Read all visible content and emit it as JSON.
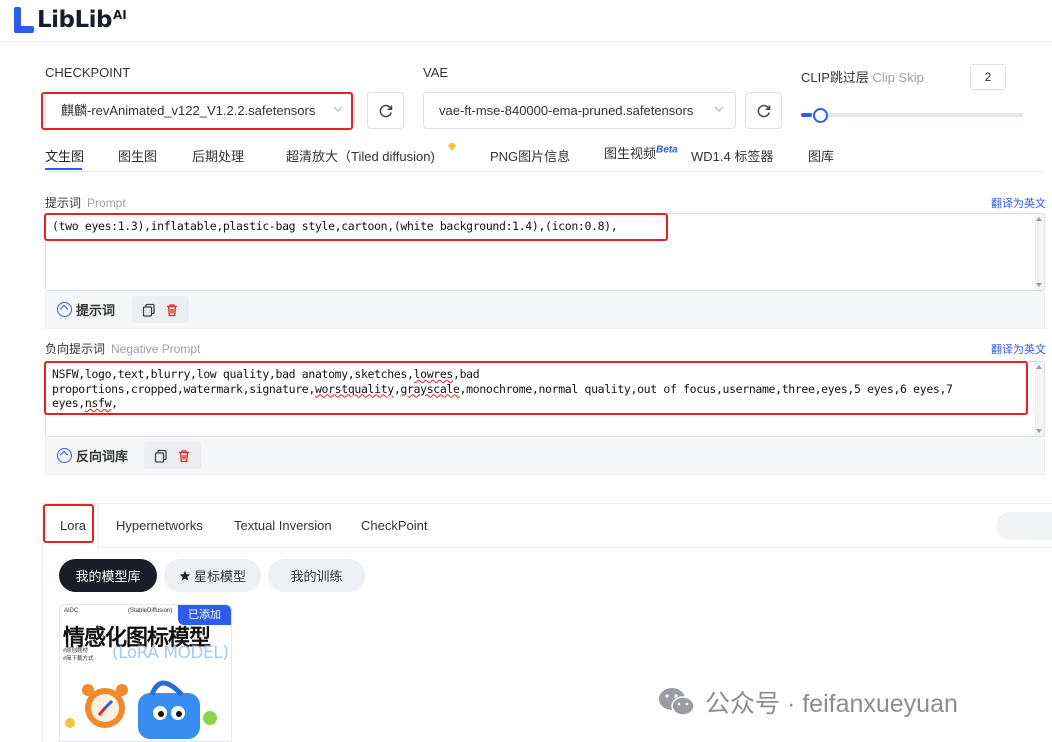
{
  "header": {
    "logo_text": "LibLib",
    "logo_sup": "AI"
  },
  "model_row": {
    "checkpoint_label": "CHECKPOINT",
    "checkpoint_value": "麒麟-revAnimated_v122_V1.2.2.safetensors",
    "vae_label": "VAE",
    "vae_value": "vae-ft-mse-840000-ema-pruned.safetensors",
    "clip_label": "CLIP跳过层",
    "clip_label_en": "Clip Skip",
    "clip_value": "2",
    "clip_slider_fraction": 0.05
  },
  "tabs": [
    {
      "label": "文生图"
    },
    {
      "label": "图生图"
    },
    {
      "label": "后期处理"
    },
    {
      "label": "超清放大（Tiled diffusion)"
    },
    {
      "label": "PNG图片信息"
    },
    {
      "label": "图生视频",
      "sup": "Beta"
    },
    {
      "label": "WD1.4 标签器"
    },
    {
      "label": "图库"
    }
  ],
  "prompt": {
    "label": "提示词",
    "label_en": "Prompt",
    "translate": "翻译为英文",
    "text": "(two eyes:1.3),inflatable,plastic-bag style,cartoon,(white background:1.4),(icon:0.8),",
    "library_button": "提示词"
  },
  "negative": {
    "label": "负向提示词",
    "label_en": "Negative Prompt",
    "translate": "翻译为英文",
    "line1_a": "NSFW,logo,text,blurry,low quality,bad anatomy,sketches,",
    "line1_sq": "lowres",
    "line1_b": ",bad",
    "line2_a": "proportions,cropped,watermark,signature,",
    "line2_sq1": "worstquality",
    "line2_b": ",",
    "line2_sq2": "grayscale",
    "line2_c": ",monochrome,normal quality,out of focus,username,three,eyes,5 eyes,6 eyes,7",
    "line3_a": "eyes,",
    "line3_sq": "nsfw",
    "line3_b": ",",
    "library_button": "反向词库"
  },
  "lower_tabs": [
    {
      "label": "Lora"
    },
    {
      "label": "Hypernetworks"
    },
    {
      "label": "Textual Inversion"
    },
    {
      "label": "CheckPoint"
    }
  ],
  "chips": [
    {
      "label": "我的模型库"
    },
    {
      "label": "星标模型"
    },
    {
      "label": "我的训练"
    }
  ],
  "card": {
    "badge": "已添加",
    "small_left": "AIDC",
    "small_right": "(StableDiffusion)",
    "title": "情感化图标模型",
    "lora": "(LoRA MODEL)",
    "sub1": "#原创题材",
    "sub2": "#简下载方式"
  },
  "watermark": {
    "text": "公众号 · feifanxueyuan"
  },
  "colors": {
    "accent": "#2f5bea",
    "highlight_box": "#e02424",
    "dark_chip": "#1a1d29"
  }
}
